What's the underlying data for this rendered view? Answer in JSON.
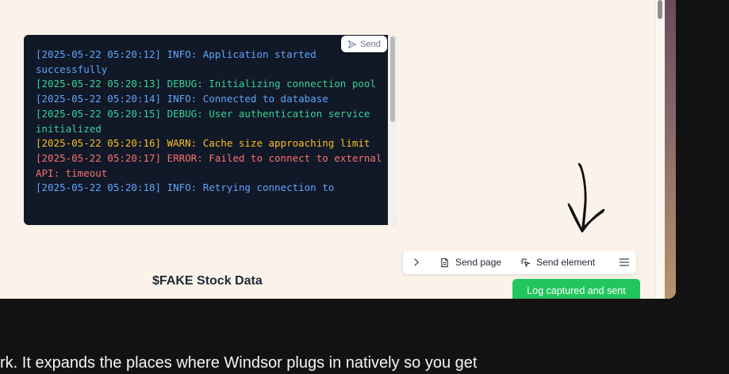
{
  "log_panel": {
    "send_label": "Send",
    "entries": [
      {
        "text": "[2025-05-22 05:20:12] INFO: Application started successfully",
        "level": "INFO"
      },
      {
        "text": "[2025-05-22 05:20:13] DEBUG: Initializing connection pool",
        "level": "DEBUG"
      },
      {
        "text": "[2025-05-22 05:20:14] INFO: Connected to database",
        "level": "INFO"
      },
      {
        "text": "[2025-05-22 05:20:15] DEBUG: User authentication service initialized",
        "level": "DEBUG"
      },
      {
        "text": "[2025-05-22 05:20:16] WARN: Cache size approaching limit",
        "level": "WARN"
      },
      {
        "text": "[2025-05-22 05:20:17] ERROR: Failed to connect to external API: timeout",
        "level": "ERROR"
      },
      {
        "text": "[2025-05-22 05:20:18] INFO: Retrying connection to",
        "level": "INFO"
      }
    ]
  },
  "toolbar": {
    "send_page_label": "Send page",
    "send_element_label": "Send element"
  },
  "page": {
    "stock_title": "$FAKE Stock Data"
  },
  "toast": {
    "message": "Log captured and sent",
    "color": "#22c55e"
  },
  "caption": {
    "text": "rk. It expands the places where Windsor plugs in natively so you get"
  },
  "colors": {
    "page_bg": "#fbf3ea",
    "log_bg": "#111827",
    "info": "#60a5fa",
    "debug": "#34d399",
    "warn": "#fbbf24",
    "error": "#f87171"
  }
}
